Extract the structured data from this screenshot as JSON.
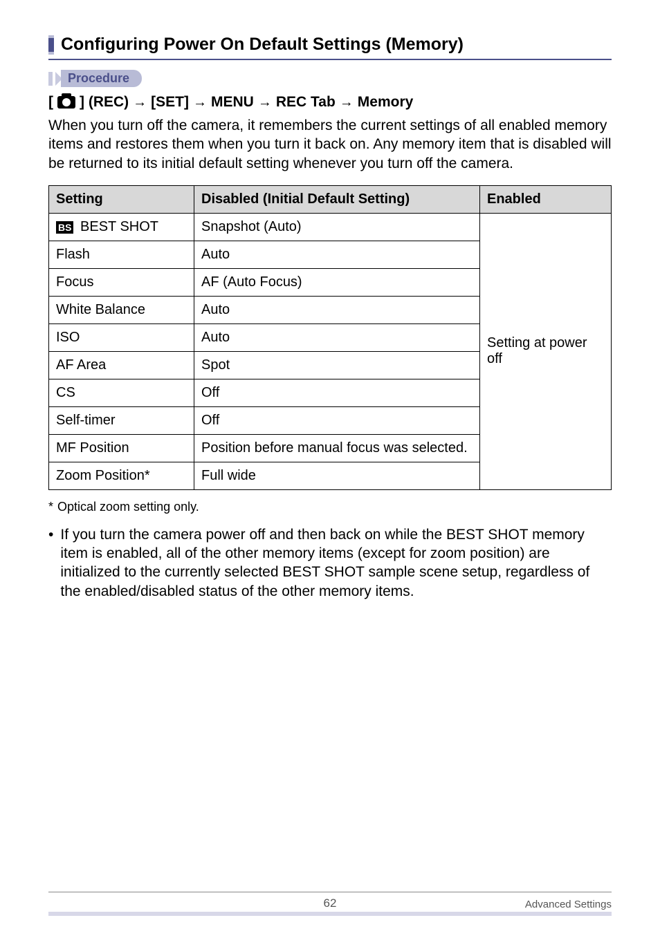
{
  "heading": "Configuring Power On Default Settings (Memory)",
  "procedure_label": "Procedure",
  "path": {
    "p1_prefix": "[",
    "p1_suffix": "] (REC)",
    "p2": "[SET]",
    "p3": "MENU",
    "p4": "REC Tab",
    "p5": "Memory"
  },
  "intro": "When you turn off the camera, it remembers the current settings of all enabled memory items and restores them when you turn it back on. Any memory item that is disabled will be returned to its initial default setting whenever you turn off the camera.",
  "table": {
    "headers": {
      "setting": "Setting",
      "disabled": "Disabled (Initial Default Setting)",
      "enabled": "Enabled"
    },
    "rows": {
      "r0": {
        "icon": "BS",
        "setting": " BEST SHOT",
        "disabled": "Snapshot (Auto)"
      },
      "r1": {
        "setting": "Flash",
        "disabled": "Auto"
      },
      "r2": {
        "setting": "Focus",
        "disabled": "AF (Auto Focus)"
      },
      "r3": {
        "setting": "White Balance",
        "disabled": "Auto"
      },
      "r4": {
        "setting": "ISO",
        "disabled": "Auto"
      },
      "r5": {
        "setting": "AF Area",
        "disabled": "Spot"
      },
      "r6": {
        "setting": "CS",
        "disabled": "Off"
      },
      "r7": {
        "setting": "Self-timer",
        "disabled": "Off"
      },
      "r8": {
        "setting": "MF Position",
        "disabled": "Position before manual focus was selected."
      },
      "r9": {
        "setting": "Zoom Position*",
        "disabled": "Full wide"
      }
    },
    "enabled_text": "Setting at power off"
  },
  "footnote_marker": "*",
  "footnote": "Optical zoom setting only.",
  "bullet": "If you turn the camera power off and then back on while the BEST SHOT memory item is enabled, all of the other memory items (except for zoom position) are initialized to the currently selected BEST SHOT sample scene setup, regardless of the enabled/disabled status of the other memory items.",
  "footer": {
    "page": "62",
    "section": "Advanced Settings"
  }
}
